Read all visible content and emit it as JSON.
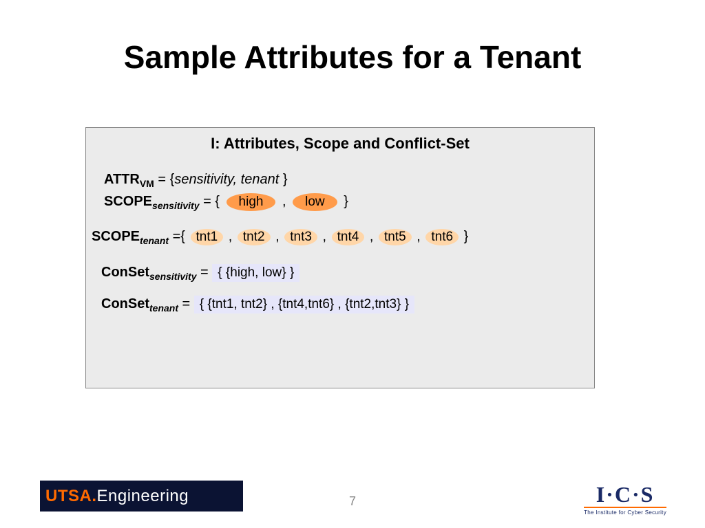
{
  "title": "Sample Attributes for a Tenant",
  "box": {
    "heading": "I: Attributes, Scope and Conflict-Set",
    "r1": {
      "label": "ATTR",
      "sub": "VM",
      "eq": "= {",
      "a": "sensitivity",
      "comma": ", ",
      "b": "tenant",
      "close": " }"
    },
    "r2": {
      "label": "SCOPE",
      "sub": "sensitivity",
      "eq": " = { ",
      "v1": "high",
      "sep": " , ",
      "v2": "low",
      "close": " }"
    },
    "r3": {
      "label": "SCOPE",
      "sub": "tenant",
      "eq": " ={ ",
      "v1": "tnt1",
      "v2": "tnt2",
      "v3": "tnt3",
      "v4": "tnt4",
      "v5": "tnt5",
      "v6": "tnt6",
      "sep": " , ",
      "close": " }"
    },
    "r4": {
      "label": "ConSet",
      "sub": "sensitivity",
      "eq": " = ",
      "val": "{  {high, low}  }"
    },
    "r5": {
      "label": "ConSet",
      "sub": "tenant",
      "eq": " =  ",
      "val": "{ {tnt1, tnt2} , {tnt4,tnt6} ,  {tnt2,tnt3} }"
    }
  },
  "footer": {
    "left": {
      "a": "UTSA",
      "dot": ".",
      "b": "Engineering"
    },
    "page": "7",
    "right": {
      "main": "I·C·S",
      "sub": "The Institute for Cyber Security"
    }
  }
}
